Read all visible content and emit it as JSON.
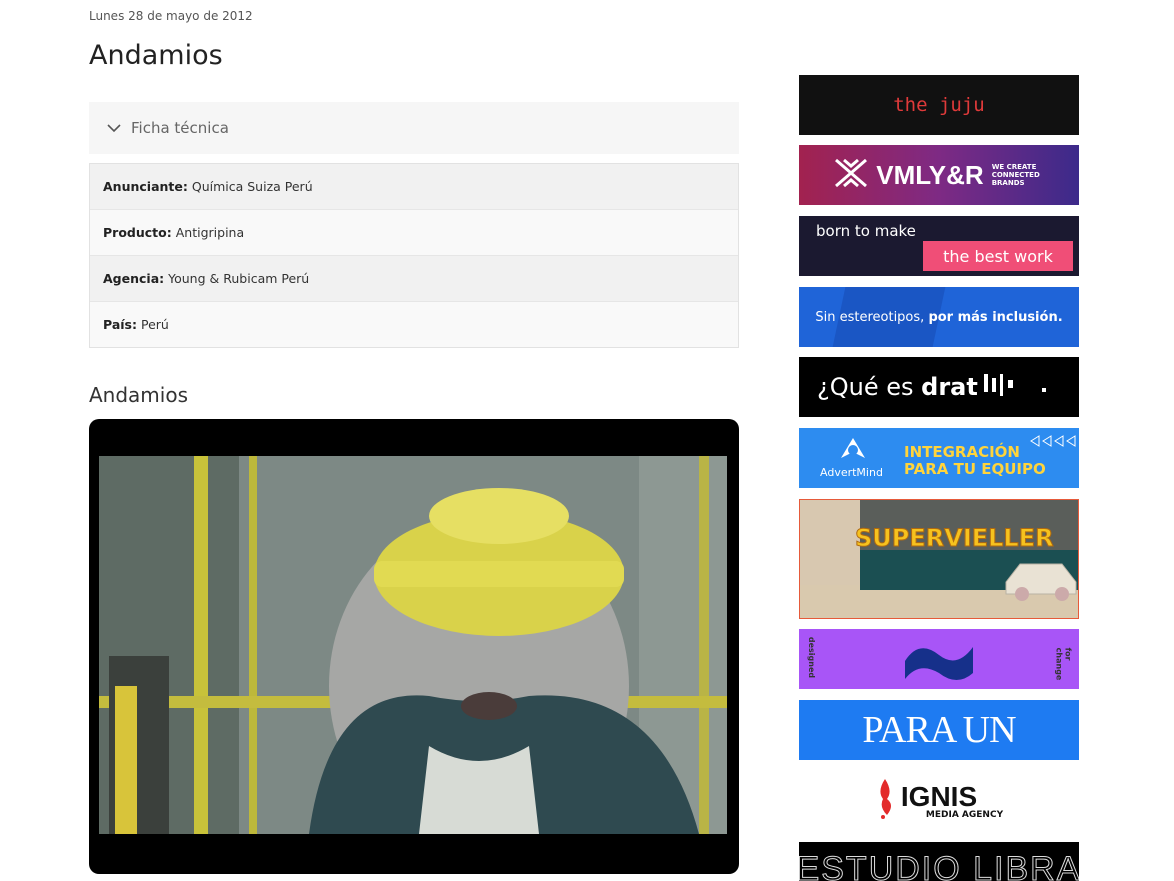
{
  "post": {
    "date": "Lunes 28 de mayo de 2012",
    "title": "Andamios",
    "accordion_label": "Ficha técnica",
    "specs": [
      {
        "label": "Anunciante:",
        "value": "Química Suiza Perú"
      },
      {
        "label": "Producto:",
        "value": "Antigripina"
      },
      {
        "label": "Agencia:",
        "value": "Young & Rubicam Perú"
      },
      {
        "label": "País:",
        "value": "Perú"
      }
    ],
    "video_title": "Andamios"
  },
  "ads": [
    {
      "text": "the juju"
    },
    {
      "brand": "VMLY&R",
      "tagline": "WE CREATE CONNECTED BRANDS"
    },
    {
      "line1": "born to make",
      "line2": "the best work"
    },
    {
      "text_normal": "Sin estereotipos, ",
      "text_bold": "por más inclusión."
    },
    {
      "text_normal": "¿Qué es ",
      "text_bold": "drat"
    },
    {
      "brand": "AdvertMind",
      "line1": "INTEGRACIÓN",
      "line2": "PARA TU EQUIPO"
    },
    {
      "text": "SUPERVIELLER"
    },
    {
      "left": "designed",
      "right": "for change"
    },
    {
      "text": "PARA UN"
    },
    {
      "brand": "IGNIS",
      "tagline": "MEDIA AGENCY"
    },
    {
      "text": "ESTUDIO LIBRA"
    }
  ],
  "colors": {
    "juju_red": "#e03a3a",
    "vml_bg": "#8a2a6e",
    "born_pink": "#f04e77",
    "blue_ad": "#1f64d8",
    "advert_blue": "#2d8cf0",
    "advert_yellow": "#ffd43b",
    "purple_ad": "#a855f7",
    "paraun_blue": "#1e7bf2",
    "ignis_red": "#e32b2b"
  }
}
